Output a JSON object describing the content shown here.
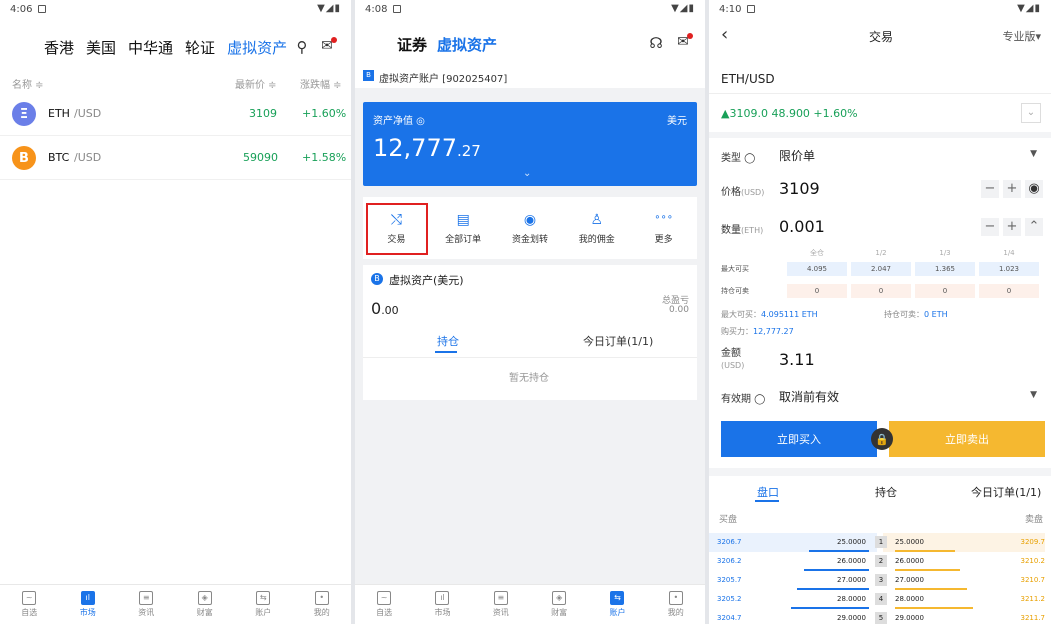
{
  "panel1": {
    "status_time": "4:06",
    "tabs": [
      "香港",
      "美国",
      "中华通",
      "轮证",
      "虚拟资产"
    ],
    "active_tab_index": 4,
    "columns": {
      "name": "名称 ≑",
      "price": "最新价 ≑",
      "change": "涨跌幅 ≑"
    },
    "rows": [
      {
        "icon": "Ξ",
        "symbol": "ETH",
        "quote": "/USD",
        "price": "3109",
        "change": "+1.60%",
        "icon_color": "#6b7fe8"
      },
      {
        "icon": "B",
        "symbol": "BTC",
        "quote": "/USD",
        "price": "59090",
        "change": "+1.58%",
        "icon_color": "#f7931a"
      }
    ],
    "nav": [
      {
        "glyph": "~",
        "label": "自选"
      },
      {
        "glyph": "ıl",
        "label": "市场"
      },
      {
        "glyph": "≡",
        "label": "资讯"
      },
      {
        "glyph": "◈",
        "label": "财富"
      },
      {
        "glyph": "⇆",
        "label": "账户"
      },
      {
        "glyph": "•",
        "label": "我的"
      }
    ],
    "nav_active_index": 1
  },
  "panel2": {
    "status_time": "4:08",
    "title_a": "证券",
    "title_b": "虚拟资产",
    "account_text": "虚拟资产账户 [902025407]",
    "networth_label": "资产净值 ◎",
    "currency": "美元",
    "networth_int": "12,777",
    "networth_dec": ".27",
    "actions": [
      {
        "icon": "⤭",
        "label": "交易"
      },
      {
        "icon": "▤",
        "label": "全部订单"
      },
      {
        "icon": "◉",
        "label": "资金划转"
      },
      {
        "icon": "♙",
        "label": "我的佣金"
      },
      {
        "icon": "∘∘∘",
        "label": "更多"
      }
    ],
    "vcard_title": "虚拟资产(美元)",
    "vcard_value_int": "0",
    "vcard_value_dec": ".00",
    "pl_label": "总盈亏",
    "pl_value": "0.00",
    "tabs": [
      "持仓",
      "今日订单(1/1)"
    ],
    "empty_text": "暂无持仓",
    "nav": [
      {
        "glyph": "~",
        "label": "自选"
      },
      {
        "glyph": "ıl",
        "label": "市场"
      },
      {
        "glyph": "≡",
        "label": "资讯"
      },
      {
        "glyph": "◈",
        "label": "财富"
      },
      {
        "glyph": "⇆",
        "label": "账户"
      },
      {
        "glyph": "•",
        "label": "我的"
      }
    ],
    "nav_active_index": 4
  },
  "panel3": {
    "status_time": "4:10",
    "title": "交易",
    "mode": "专业版▾",
    "pair": "ETH/USD",
    "quote_line": "▲3109.0 48.900 +1.60%",
    "type_label": "类型 ◯",
    "type_value": "限价单",
    "price_label": "价格",
    "price_unit": "(USD)",
    "price_value": "3109",
    "qty_label": "数量",
    "qty_unit": "(ETH)",
    "qty_value": "0.001",
    "fractions": [
      "全仓",
      "1/2",
      "1/3",
      "1/4"
    ],
    "max_buy_label": "最大可买",
    "max_buy_vals": [
      "4.095",
      "2.047",
      "1.365",
      "1.023"
    ],
    "hold_sell_label": "持仓可卖",
    "hold_sell_vals": [
      "0",
      "0",
      "0",
      "0"
    ],
    "max_buy_info_label": "最大可买：",
    "max_buy_info": "4.095111 ETH",
    "hold_sell_info_label": "持仓可卖：",
    "hold_sell_info": "0 ETH",
    "buying_power_label": "购买力：",
    "buying_power": "12,777.27",
    "amount_label": "金额",
    "amount_unit": "(USD)",
    "amount_value": "3.11",
    "validity_label": "有效期 ◯",
    "validity_value": "取消前有效",
    "buy_label": "立即买入",
    "sell_label": "立即卖出",
    "tabs": [
      "盘口",
      "持仓",
      "今日订单(1/1)"
    ],
    "bid_header": "买盘",
    "ask_header": "卖盘",
    "orderbook": [
      {
        "bid": "3206.7",
        "bid_qty": "25.0000",
        "level": "1",
        "ask_qty": "25.0000",
        "ask": "3209.7"
      },
      {
        "bid": "3206.2",
        "bid_qty": "26.0000",
        "level": "2",
        "ask_qty": "26.0000",
        "ask": "3210.2"
      },
      {
        "bid": "3205.7",
        "bid_qty": "27.0000",
        "level": "3",
        "ask_qty": "27.0000",
        "ask": "3210.7"
      },
      {
        "bid": "3205.2",
        "bid_qty": "28.0000",
        "level": "4",
        "ask_qty": "28.0000",
        "ask": "3211.2"
      },
      {
        "bid": "3204.7",
        "bid_qty": "29.0000",
        "level": "5",
        "ask_qty": "29.0000",
        "ask": "3211.7"
      }
    ]
  },
  "colors": {
    "accent": "#1a73e8",
    "up": "#18a058",
    "sell": "#f5b830",
    "highlight": "#e02020"
  }
}
